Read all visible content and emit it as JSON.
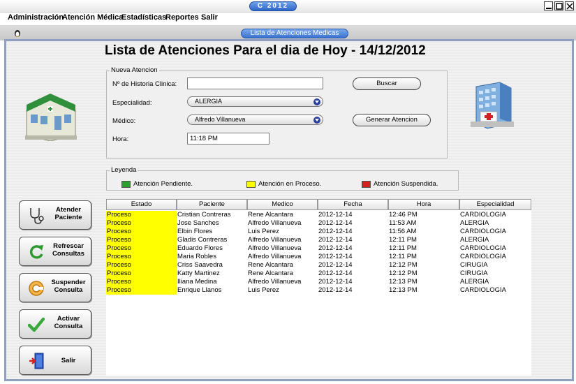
{
  "window": {
    "title": "C 2012"
  },
  "menu": [
    "Administración",
    "Atención Médica",
    "Estadísticas",
    "Reportes",
    "Salir"
  ],
  "frame": {
    "title": "Lista de Atenciones Medicas"
  },
  "page_title": "Lista de Atenciones Para el dia de Hoy - 14/12/2012",
  "form": {
    "legend": "Nueva Atencion",
    "historia_label": "Nº de Historia Clinica:",
    "historia_value": "",
    "especialidad_label": "Especialidad:",
    "especialidad_value": "ALERGIA",
    "medico_label": "Médico:",
    "medico_value": "Alfredo Villanueva",
    "hora_label": "Hora:",
    "hora_value": "11:18 PM",
    "buscar_label": "Buscar",
    "generar_label": "Generar Atencion"
  },
  "leyenda": {
    "legend": "Leyenda",
    "items": [
      {
        "label": "Atención Pendiente.",
        "color": "#2ea02e"
      },
      {
        "label": "Atención en Proceso.",
        "color": "#ffff00"
      },
      {
        "label": "Atención Suspendida.",
        "color": "#d42020"
      }
    ]
  },
  "side_buttons": [
    {
      "label": "Atender\nPaciente",
      "icon": "stethoscope-icon"
    },
    {
      "label": "Refrescar\nConsultas",
      "icon": "refresh-icon"
    },
    {
      "label": "Suspender\nConsulta",
      "icon": "suspend-icon"
    },
    {
      "label": "Activar\nConsulta",
      "icon": "checkmark-icon"
    },
    {
      "label": "Salir",
      "icon": "exit-door-icon"
    }
  ],
  "table": {
    "columns": [
      "Estado",
      "Paciente",
      "Medico",
      "Fecha",
      "Hora",
      "Especialidad"
    ],
    "rows": [
      [
        "Proceso",
        "Cristian Contreras",
        "Rene Alcantara",
        "2012-12-14",
        "12:46 PM",
        "CARDIOLOGIA"
      ],
      [
        "Proceso",
        "Jose Sanches",
        "Alfredo Villanueva",
        "2012-12-14",
        "11:53 AM",
        "ALERGIA"
      ],
      [
        "Proceso",
        "Elbin Flores",
        "Luis Perez",
        "2012-12-14",
        "11:56 AM",
        "CARDIOLOGIA"
      ],
      [
        "Proceso",
        "Gladis Contreras",
        "Alfredo Villanueva",
        "2012-12-14",
        "12:11 PM",
        "ALERGIA"
      ],
      [
        "Proceso",
        "Eduardo Flores",
        "Alfredo Villanueva",
        "2012-12-14",
        "12:11 PM",
        "CARDIOLOGIA"
      ],
      [
        "Proceso",
        "Maria Robles",
        "Alfredo Villanueva",
        "2012-12-14",
        "12:11 PM",
        "CARDIOLOGIA"
      ],
      [
        "Proceso",
        "Criss Saavedra",
        "Rene Alcantara",
        "2012-12-14",
        "12:12 PM",
        "CIRUGIA"
      ],
      [
        "Proceso",
        "Katty Martinez",
        "Rene Alcantara",
        "2012-12-14",
        "12:12 PM",
        "CIRUGIA"
      ],
      [
        "Proceso",
        "Iliana Medina",
        "Alfredo Villanueva",
        "2012-12-14",
        "12:13 PM",
        "ALERGIA"
      ],
      [
        "Proceso",
        "Enrique Llanos",
        "Luis Perez",
        "2012-12-14",
        "12:13 PM",
        "CARDIOLOGIA"
      ]
    ]
  },
  "colors": {
    "state_process": "#ffff00",
    "frame_accent": "#3a72cf"
  }
}
